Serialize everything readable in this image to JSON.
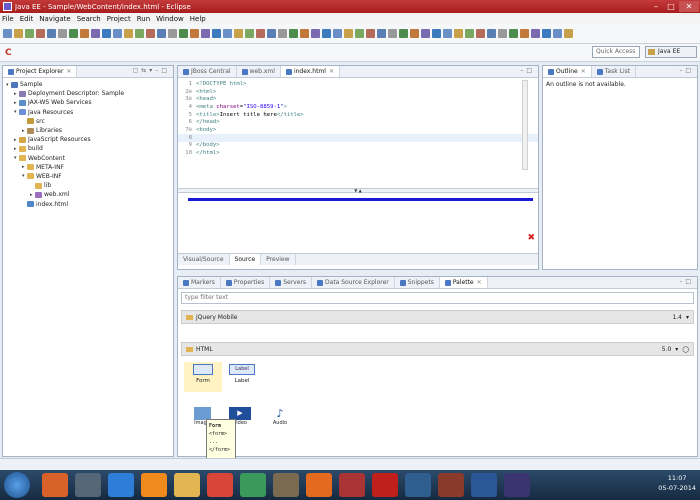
{
  "window": {
    "title": "Java EE - Sample/WebContent/index.html - Eclipse"
  },
  "menu": [
    "File",
    "Edit",
    "Navigate",
    "Search",
    "Project",
    "Run",
    "Window",
    "Help"
  ],
  "toolbar": {
    "quick_access": "Quick Access",
    "perspective": "Java EE"
  },
  "project_explorer": {
    "tab_label": "Project Explorer",
    "items": [
      {
        "label": "Sample",
        "depth": 0,
        "twisty": "▾",
        "icon": "project-icon",
        "color": "#5277b8"
      },
      {
        "label": "Deployment Descriptor: Sample",
        "depth": 1,
        "twisty": "▸",
        "icon": "descriptor-icon",
        "color": "#8a7bb0"
      },
      {
        "label": "JAX-WS Web Services",
        "depth": 1,
        "twisty": "▸",
        "icon": "webservice-icon",
        "color": "#5c8fc9"
      },
      {
        "label": "Java Resources",
        "depth": 1,
        "twisty": "▾",
        "icon": "java-resources-icon",
        "color": "#6e8ed6"
      },
      {
        "label": "src",
        "depth": 2,
        "twisty": "",
        "icon": "package-folder-icon",
        "color": "#c49b3a"
      },
      {
        "label": "Libraries",
        "depth": 2,
        "twisty": "▸",
        "icon": "library-icon",
        "color": "#b08b5a"
      },
      {
        "label": "JavaScript Resources",
        "depth": 1,
        "twisty": "▸",
        "icon": "javascript-icon",
        "color": "#d6a843"
      },
      {
        "label": "build",
        "depth": 1,
        "twisty": "▸",
        "icon": "folder-icon",
        "color": "#e3b552"
      },
      {
        "label": "WebContent",
        "depth": 1,
        "twisty": "▾",
        "icon": "folder-icon",
        "color": "#e3b552"
      },
      {
        "label": "META-INF",
        "depth": 2,
        "twisty": "▸",
        "icon": "folder-icon",
        "color": "#e3b552"
      },
      {
        "label": "WEB-INF",
        "depth": 2,
        "twisty": "▾",
        "icon": "folder-icon",
        "color": "#e3b552"
      },
      {
        "label": "lib",
        "depth": 3,
        "twisty": "",
        "icon": "folder-icon",
        "color": "#e3b552"
      },
      {
        "label": "web.xml",
        "depth": 3,
        "twisty": "▸",
        "icon": "xml-file-icon",
        "color": "#9a6dbf"
      },
      {
        "label": "index.html",
        "depth": 2,
        "twisty": "",
        "icon": "html-file-icon",
        "color": "#4f86c6"
      }
    ]
  },
  "editor": {
    "tabs": [
      {
        "label": "JBoss Central",
        "active": false
      },
      {
        "label": "web.xml",
        "active": false
      },
      {
        "label": "index.html",
        "active": true
      }
    ],
    "lines": [
      {
        "n": "1",
        "html": "<span class='tag'>&lt;!DOCTYPE html&gt;</span>"
      },
      {
        "n": "2⊖",
        "html": "<span class='tag'>&lt;html&gt;</span>"
      },
      {
        "n": "3⊖",
        "html": "<span class='tag'>&lt;head&gt;</span>"
      },
      {
        "n": "4",
        "html": "<span class='tag'>&lt;meta </span><span class='attr'>charset</span>=<span class='val'>\"ISO-8859-1\"</span><span class='tag'>&gt;</span>"
      },
      {
        "n": "5",
        "html": "<span class='tag'>&lt;title&gt;</span><span class='txt'>Insert title here</span><span class='tag'>&lt;/title&gt;</span>"
      },
      {
        "n": "6",
        "html": "<span class='tag'>&lt;/head&gt;</span>"
      },
      {
        "n": "7⊖",
        "html": "<span class='tag'>&lt;body&gt;</span>"
      },
      {
        "n": "8",
        "html": "",
        "current": true
      },
      {
        "n": "9",
        "html": "<span class='tag'>&lt;/body&gt;</span>"
      },
      {
        "n": "10",
        "html": "<span class='tag'>&lt;/html&gt;</span>"
      }
    ],
    "bottom_tabs": [
      "Visual/Source",
      "Source",
      "Preview"
    ]
  },
  "outline": {
    "tabs": [
      {
        "label": "Outline",
        "active": true
      },
      {
        "label": "Task List",
        "active": false
      }
    ],
    "message": "An outline is not available."
  },
  "bottom_panel": {
    "tabs": [
      {
        "label": "Markers",
        "active": false
      },
      {
        "label": "Properties",
        "active": false
      },
      {
        "label": "Servers",
        "active": false
      },
      {
        "label": "Data Source Explorer",
        "active": false
      },
      {
        "label": "Snippets",
        "active": false
      },
      {
        "label": "Palette",
        "active": true
      }
    ],
    "filter_placeholder": "type filter text",
    "groups": [
      {
        "label": "jQuery Mobile",
        "version": "1.4"
      },
      {
        "label": "HTML",
        "version": "5.0"
      }
    ],
    "palette_items": [
      "Form",
      "Label"
    ],
    "palette_items_row2": [
      "Image",
      "Video",
      "Audio"
    ],
    "tooltip": [
      "Form",
      "<form>",
      "...",
      "</form>"
    ]
  },
  "taskbar": {
    "apps": [
      {
        "icon": "media-player-icon",
        "color": "#d9622b"
      },
      {
        "icon": "user-icon",
        "color": "#556677"
      },
      {
        "icon": "internet-explorer-icon",
        "color": "#2e7dd7"
      },
      {
        "icon": "vlc-icon",
        "color": "#f08a1c"
      },
      {
        "icon": "folder-icon",
        "color": "#e3b552"
      },
      {
        "icon": "chrome-icon",
        "color": "#d8463a"
      },
      {
        "icon": "app-icon",
        "color": "#3a9a5b"
      },
      {
        "icon": "app-icon",
        "color": "#7a6a4f"
      },
      {
        "icon": "firefox-icon",
        "color": "#e36a1f"
      },
      {
        "icon": "app-icon",
        "color": "#a33"
      },
      {
        "icon": "acrobat-icon",
        "color": "#c0201c"
      },
      {
        "icon": "app-icon",
        "color": "#2f5f8f"
      },
      {
        "icon": "app-icon",
        "color": "#8a3a2a"
      },
      {
        "icon": "word-icon",
        "color": "#2b5797"
      },
      {
        "icon": "eclipse-icon",
        "color": "#3a3570"
      }
    ],
    "time": "11:07",
    "date": "05-07-2014"
  }
}
